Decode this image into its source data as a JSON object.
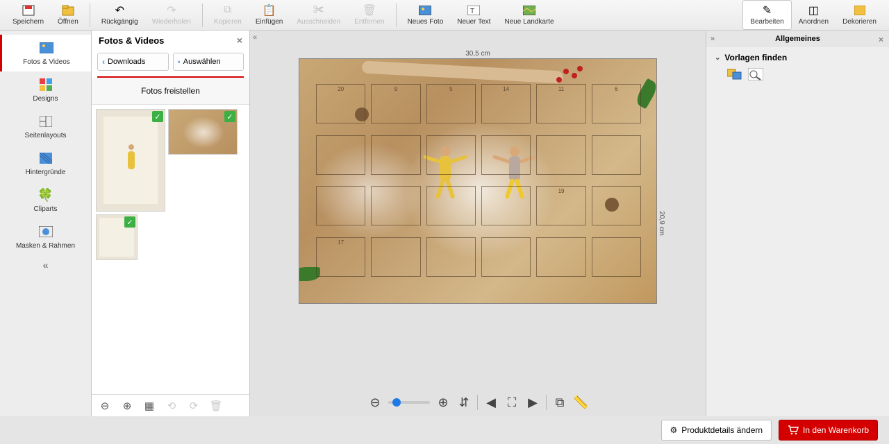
{
  "toolbar": {
    "save": "Speichern",
    "open": "Öffnen",
    "undo": "Rückgängig",
    "redo": "Wiederholen",
    "copy": "Kopieren",
    "paste": "Einfügen",
    "cut": "Ausschneiden",
    "remove": "Entfernen",
    "new_photo": "Neues Foto",
    "new_text": "Neuer Text",
    "new_map": "Neue Landkarte",
    "edit": "Bearbeiten",
    "arrange": "Anordnen",
    "decorate": "Dekorieren"
  },
  "vnav": {
    "photos": "Fotos & Videos",
    "designs": "Designs",
    "layouts": "Seitenlayouts",
    "backgrounds": "Hintergründe",
    "cliparts": "Cliparts",
    "masks": "Masken & Rahmen"
  },
  "photos_panel": {
    "title": "Fotos & Videos",
    "downloads": "Downloads",
    "select": "Auswählen",
    "crop_label": "Fotos freistellen"
  },
  "canvas": {
    "width_label": "30,5 cm",
    "height_label": "20,9 cm",
    "doors": [
      "20",
      "9",
      "5",
      "14",
      "11",
      "6",
      "",
      "",
      "",
      "",
      "",
      "",
      "",
      "",
      "",
      "",
      "19",
      "",
      "17",
      "",
      "",
      "",
      "",
      "",
      ""
    ]
  },
  "right_panel": {
    "title": "Allgemeines",
    "templates": "Vorlagen finden"
  },
  "footer": {
    "details": "Produktdetails ändern",
    "cart": "In den Warenkorb"
  }
}
